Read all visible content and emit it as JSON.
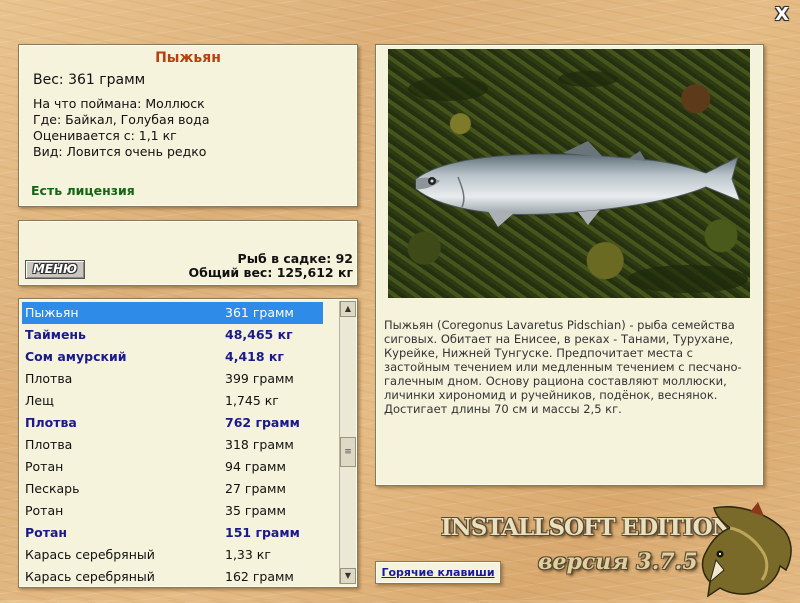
{
  "close_symbol": "X",
  "fish": {
    "title": "Пыжьян",
    "weight": "Вес: 361 грамм",
    "caught_on": "На что поймана: Моллюск",
    "where": "Где: Байкал, Голубая вода",
    "valued_from": "Оценивается с: 1,1 кг",
    "kind": "Вид: Ловится очень редко",
    "license": "Есть лицензия"
  },
  "stats": {
    "menu_label": "МЕНЮ",
    "fish_in_cage": "Рыб в садке: 92",
    "total_weight": "Общий вес: 125,612 кг"
  },
  "list": [
    {
      "name": "Пыжьян",
      "weight": "361 грамм",
      "bold": false,
      "selected": true
    },
    {
      "name": "Таймень",
      "weight": "48,465 кг",
      "bold": true,
      "selected": false
    },
    {
      "name": "Сом амурский",
      "weight": "4,418 кг",
      "bold": true,
      "selected": false
    },
    {
      "name": "Плотва",
      "weight": "399 грамм",
      "bold": false,
      "selected": false
    },
    {
      "name": "Лещ",
      "weight": "1,745 кг",
      "bold": false,
      "selected": false
    },
    {
      "name": "Плотва",
      "weight": "762 грамм",
      "bold": true,
      "selected": false
    },
    {
      "name": "Плотва",
      "weight": "318 грамм",
      "bold": false,
      "selected": false
    },
    {
      "name": "Ротан",
      "weight": "94 грамм",
      "bold": false,
      "selected": false
    },
    {
      "name": "Пескарь",
      "weight": "27 грамм",
      "bold": false,
      "selected": false
    },
    {
      "name": "Ротан",
      "weight": "35 грамм",
      "bold": false,
      "selected": false
    },
    {
      "name": "Ротан",
      "weight": "151 грамм",
      "bold": true,
      "selected": false
    },
    {
      "name": "Карась серебряный",
      "weight": "1,33 кг",
      "bold": false,
      "selected": false
    },
    {
      "name": "Карась серебряный",
      "weight": "162 грамм",
      "bold": false,
      "selected": false
    }
  ],
  "description": "Пыжьян (Coregonus Lavaretus Pidschian) - рыба семейства сиговых. Обитает на Енисее, в реках - Танами, Турухане, Курейке, Нижней Тунгуске. Предпочитает места с застойным течением или медленным течением с песчано-галечным дном. Основу рациона составляют моллюски, личинки хирономид и ручейников, подёнок, веснянок. Достигает длины 70 см и массы 2,5 кг.",
  "hotkeys_label": "Горячие клавиши",
  "branding": {
    "edition": "INSTALLSOFT EDITION",
    "version": "версия 3.7.5"
  },
  "colors": {
    "title": "#b84010",
    "license": "#136513",
    "bold_row": "#1a1a8a",
    "selection": "#2f8be8"
  },
  "icons": {
    "close": "close-icon",
    "scroll_up": "scroll-up-arrow-icon",
    "scroll_down": "scroll-down-arrow-icon",
    "logo": "pike-fish-logo"
  }
}
